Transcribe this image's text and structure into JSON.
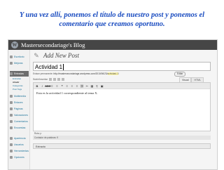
{
  "caption": {
    "line1": "Y una vez allí, ponemos el título de nuestro post y ponemos el",
    "line2": "comentario que creamos oportuno."
  },
  "admin_bar": {
    "blog_name": "Mastersecondariage's Blog"
  },
  "sidebar": {
    "items": [
      {
        "label": "Escritorio",
        "icon": "dashboard-icon"
      },
      {
        "label": "Mejoras",
        "icon": "upgrades-icon"
      },
      {
        "label": "Entradas",
        "icon": "posts-icon",
        "active": true
      },
      {
        "label": "Multimedia",
        "icon": "media-icon"
      },
      {
        "label": "Enlaces",
        "icon": "links-icon"
      },
      {
        "label": "Páginas",
        "icon": "pages-icon"
      },
      {
        "label": "Valoraciones",
        "icon": "ratings-icon"
      },
      {
        "label": "Comentarios",
        "icon": "comments-icon"
      },
      {
        "label": "Encuestas",
        "icon": "polls-icon"
      },
      {
        "label": "Apariencia",
        "icon": "appearance-icon"
      },
      {
        "label": "Usuarios",
        "icon": "users-icon"
      },
      {
        "label": "Herramientas",
        "icon": "tools-icon"
      },
      {
        "label": "Opciones",
        "icon": "settings-icon"
      }
    ],
    "subitems": [
      "Entradas",
      "Añadir",
      "Categorías",
      "Post Tags"
    ]
  },
  "main": {
    "page_title": "Add New Post",
    "title_value": "Actividad 1",
    "permalink_label": "Enlace permanente:",
    "permalink_url": "http://mastersecondariage.wordpress.com/2010/06/23/",
    "permalink_slug": "actividad-1",
    "edit_label": "Editar",
    "upload_label": "Subir/Insertar",
    "tabs": [
      "Visual",
      "HTML"
    ],
    "toolbar_icons": [
      "B",
      "I",
      "ABC",
      "≡",
      "≡",
      "❝",
      "≡",
      "≡",
      "≡",
      "⛓",
      "✂",
      "▦",
      "¶",
      "▣"
    ],
    "content": "Esta es la actividad 1 correspondiente al tema X.",
    "path_label": "Ruta: p",
    "word_count": "Contador de palabras: 9",
    "excerpt_label": "Extracto"
  }
}
